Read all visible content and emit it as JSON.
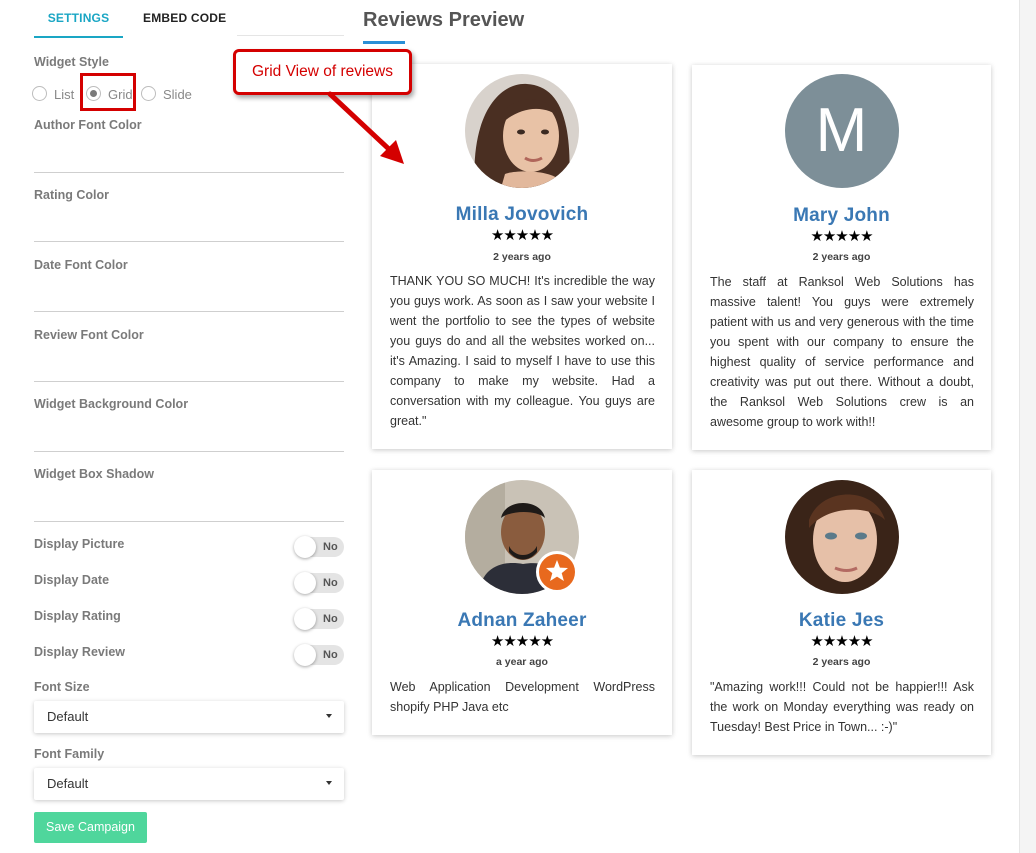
{
  "tabs": {
    "settings": "SETTINGS",
    "embed": "EMBED CODE"
  },
  "sidebar": {
    "widget_style": {
      "label": "Widget Style",
      "options": [
        "List",
        "Grid",
        "Slide"
      ],
      "selected": "Grid"
    },
    "color_fields": [
      "Author Font Color",
      "Rating Color",
      "Date Font Color",
      "Review Font Color",
      "Widget Background Color",
      "Widget Box Shadow"
    ],
    "toggles": [
      {
        "label": "Display Picture",
        "value": "No"
      },
      {
        "label": "Display Date",
        "value": "No"
      },
      {
        "label": "Display Rating",
        "value": "No"
      },
      {
        "label": "Display Review",
        "value": "No"
      }
    ],
    "font_size": {
      "label": "Font Size",
      "value": "Default"
    },
    "font_family": {
      "label": "Font Family",
      "value": "Default"
    },
    "save_label": "Save Campaign"
  },
  "preview": {
    "title": "Reviews Preview",
    "reviews": [
      {
        "author": "Milla Jovovich",
        "rating": 5,
        "stars": "★★★★★",
        "date": "2 years ago",
        "text": "THANK YOU SO MUCH! It's incredible the way you guys work. As soon as I saw your website I went the portfolio to see the types of website you guys do and all the websites worked on... it's Amazing. I said to myself I have to use this company to make my website. Had a conversation with my colleague. You guys are great.\""
      },
      {
        "author": "Mary John",
        "initial": "M",
        "rating": 5,
        "stars": "★★★★★",
        "date": "2 years ago",
        "text": "The staff at Ranksol Web Solutions has massive talent! You guys were extremely patient with us and very generous with the time you spent with our company to ensure the highest quality of service performance and creativity was put out there. Without a doubt, the Ranksol Web Solutions crew is an awesome group to work with!!"
      },
      {
        "author": "Adnan Zaheer",
        "rating": 5,
        "stars": "★★★★★",
        "date": "a year ago",
        "text": "Web Application Development WordPress shopify PHP Java etc"
      },
      {
        "author": "Katie Jes",
        "rating": 5,
        "stars": "★★★★★",
        "date": "2 years ago",
        "text": "\"Amazing work!!! Could not be happier!!! Ask the work on Monday everything was ready on Tuesday! Best Price in Town... :-)\""
      }
    ]
  },
  "annotation": {
    "text": "Grid View of reviews"
  },
  "colors": {
    "accent_tab": "#1aa6c4",
    "author_name": "#3a78b4",
    "save_button": "#4fd69c",
    "annotation_red": "#d40000",
    "avatar_placeholder": "#7d8f98",
    "badge_orange": "#e8691e"
  }
}
